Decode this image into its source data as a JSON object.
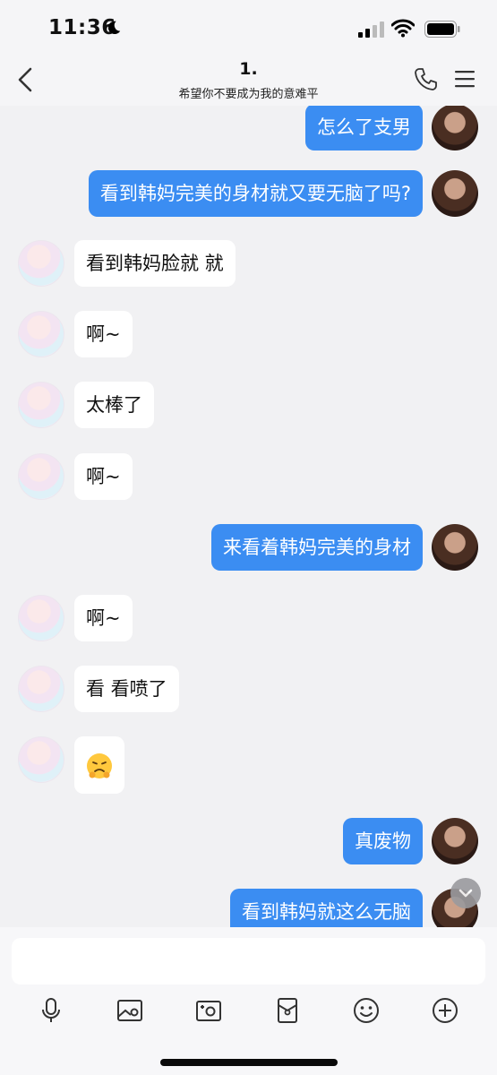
{
  "status": {
    "time": "11:36"
  },
  "nav": {
    "title": "1.",
    "subtitle": "希望你不要成为我的意难平"
  },
  "messages": [
    {
      "side": "sent",
      "text": "怎么了支男"
    },
    {
      "side": "sent",
      "text": "看到韩妈完美的身材就又要无脑了吗?"
    },
    {
      "side": "recv",
      "text": "看到韩妈脸就 就"
    },
    {
      "side": "recv",
      "text": "啊~"
    },
    {
      "side": "recv",
      "text": "太棒了"
    },
    {
      "side": "recv",
      "text": "啊~"
    },
    {
      "side": "sent",
      "text": "来看着韩妈完美的身材"
    },
    {
      "side": "recv",
      "text": "啊~"
    },
    {
      "side": "recv",
      "text": "看 看喷了"
    },
    {
      "side": "recv",
      "emoji": "sad-face-emoji"
    },
    {
      "side": "sent",
      "text": "真废物"
    },
    {
      "side": "sent",
      "text": "看到韩妈就这么无脑"
    }
  ],
  "input": {
    "placeholder": ""
  },
  "toolbar": [
    "microphone-icon",
    "image-icon",
    "camera-icon",
    "red-packet-icon",
    "emoji-icon",
    "plus-icon"
  ],
  "colors": {
    "sent_bubble": "#3b8df2",
    "recv_bubble": "#ffffff",
    "background": "#f1f1f3"
  }
}
